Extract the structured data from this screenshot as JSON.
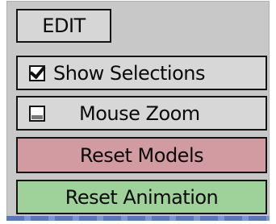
{
  "panel": {
    "edit_label": "EDIT",
    "show_selections": {
      "label": "Show  Selections",
      "checked": true
    },
    "mouse_zoom": {
      "label": "Mouse  Zoom",
      "checked": false
    },
    "reset_models_label": "Reset  Models",
    "reset_animation_label": "Reset  Animation"
  },
  "colors": {
    "panel_bg": "#c8c8c8",
    "button_bg": "#d7d7d7",
    "reset_models_bg": "#d29aa1",
    "reset_animation_bg": "#9fd29b"
  }
}
